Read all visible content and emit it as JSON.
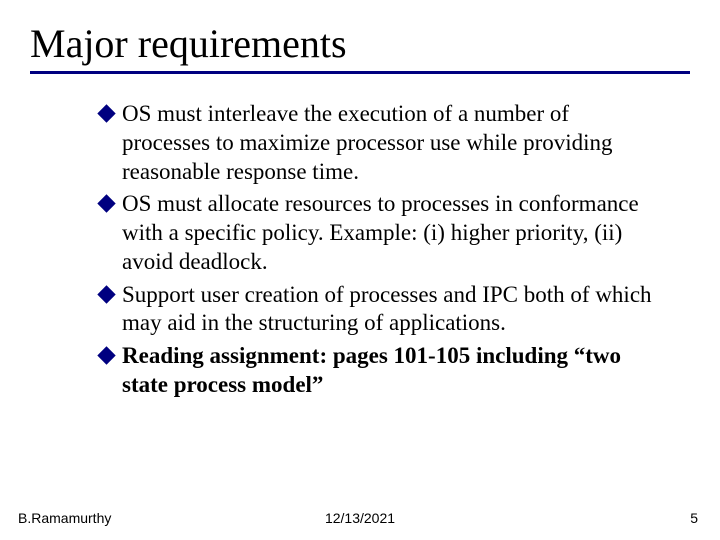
{
  "title": "Major requirements",
  "bullets": [
    {
      "text": "OS must interleave the execution of a number of processes to maximize processor use while providing reasonable response time.",
      "bold": false
    },
    {
      "text": "OS must allocate resources to processes in conformance with a specific policy. Example: (i) higher priority, (ii) avoid deadlock.",
      "bold": false
    },
    {
      "text": "Support user creation of processes and IPC both of which may aid in the structuring of applications.",
      "bold": false
    },
    {
      "text": "Reading assignment: pages 101-105 including “two state process model”",
      "bold": true
    }
  ],
  "footer": {
    "left": "B.Ramamurthy",
    "center": "12/13/2021",
    "right": "5"
  },
  "colors": {
    "accent": "#000080"
  }
}
